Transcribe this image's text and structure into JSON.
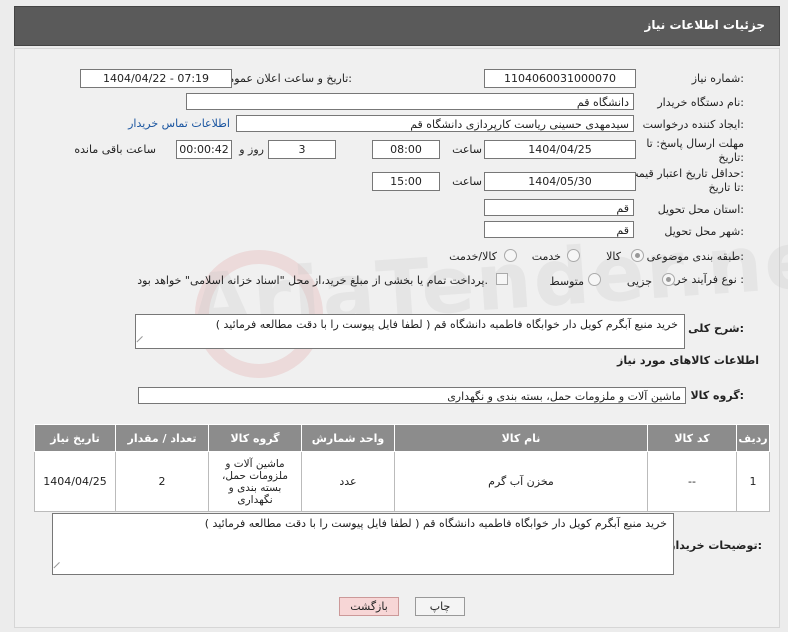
{
  "page": {
    "title": "جزئیات اطلاعات نیاز"
  },
  "watermark": {
    "text": "AriaTender.net"
  },
  "fields": {
    "need_number_label": "شماره نیاز:",
    "need_number": "1104060031000070",
    "announce_label": "تاریخ و ساعت اعلان عمومی:",
    "announce_value": "1404/04/22 - 07:19",
    "buyer_org_label": "نام دستگاه خریدار:",
    "buyer_org": "دانشگاه قم",
    "creator_label": "ایجاد کننده درخواست:",
    "creator": "سیدمهدی حسینی ریاست کارپردازی دانشگاه قم",
    "contact_link": "اطلاعات تماس خریدار",
    "deadline_label_1": "مهلت ارسال پاسخ: تا",
    "deadline_label_2": "تاریخ:",
    "deadline_date": "1404/04/25",
    "time_label": "ساعت",
    "deadline_time": "08:00",
    "days_value": "3",
    "days_label": "روز و",
    "remaining_time": "00:00:42",
    "remaining_label": "ساعت باقی مانده",
    "min_valid_label_1": "حداقل تاریخ اعتبار قیمت:",
    "min_valid_label_2": "تا تاریخ:",
    "valid_date": "1404/05/30",
    "valid_time": "15:00",
    "province_label": "استان محل تحویل:",
    "province": "قم",
    "city_label": "شهر محل تحویل:",
    "city": "قم",
    "category_label": "طبقه بندی موضوعی:",
    "category_options": [
      "کالا",
      "خدمت",
      "کالا/خدمت"
    ],
    "category_selected": "کالا",
    "purchase_type_label": "نوع فرآیند خرید :",
    "purchase_options": [
      "جزیی",
      "متوسط"
    ],
    "purchase_selected": "جزیی",
    "payment_note": "پرداخت تمام یا بخشی از مبلغ خرید،از محل \"اسناد خزانه اسلامی\" خواهد بود.",
    "general_desc_label": "شرح کلی نیاز:",
    "general_desc": "خرید منبع آبگرم کویل دار خوابگاه فاطمیه دانشگاه قم  ( لطفا فایل پیوست را با دقت مطالعه فرمائید )",
    "goods_info_title": "اطلاعات کالاهای مورد نیاز",
    "goods_group_label": "گروه کالا:",
    "goods_group": "ماشین آلات و ملزومات حمل، بسته بندی و نگهداری"
  },
  "table": {
    "headers": [
      "ردیف",
      "کد کالا",
      "نام کالا",
      "واحد شمارش",
      "گروه کالا",
      "تعداد / مقدار",
      "تاریخ نیاز"
    ],
    "rows": [
      [
        "1",
        "--",
        "مخزن آب گرم",
        "عدد",
        "ماشین آلات و ملزومات حمل، بسته بندی و نگهداری",
        "2",
        "1404/04/25"
      ]
    ]
  },
  "buyer_notes": {
    "label": "توضیحات خریدار:",
    "text": "خرید منبع آبگرم کویل دار خوابگاه فاطمیه دانشگاه قم  ( لطفا فایل پیوست را با دقت مطالعه فرمائید )"
  },
  "buttons": {
    "print": "چاپ",
    "back": "بازگشت"
  },
  "colors": {
    "header_bg": "#5a5a5a",
    "table_header_bg": "#8c8c8c",
    "link": "#1a55a0",
    "back_button_bg": "#f7d6d6"
  }
}
